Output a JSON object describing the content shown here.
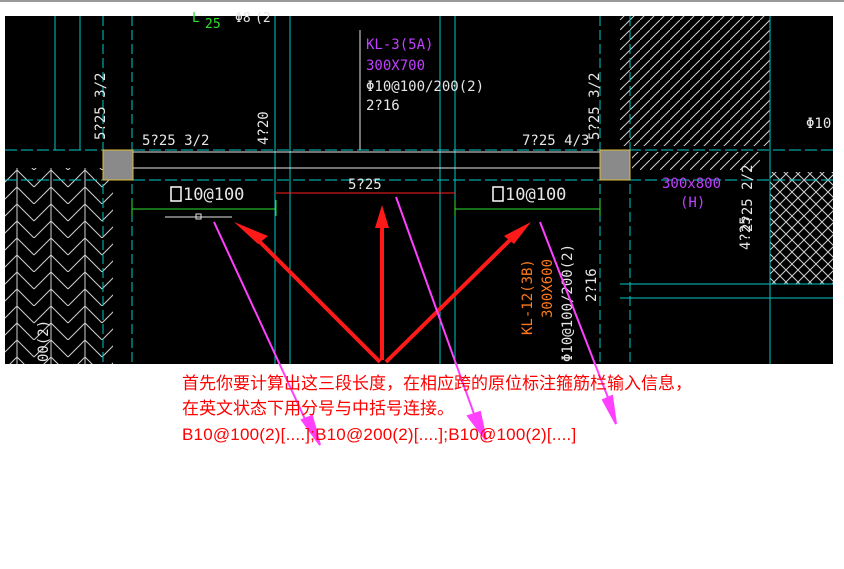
{
  "colors": {
    "background": "#000000",
    "axis_cyan": "#00c8c8",
    "beam_white": "#e6e6e6",
    "label_magenta": "#c040ff",
    "label_orange": "#ff7a1a",
    "arrow_red": "#ff1a1a",
    "arrow_magenta": "#ff40ff",
    "dim_green": "#30e030",
    "note_red": "#ff0000",
    "column_gray": "#8a8a8a"
  },
  "drawing": {
    "left_top_labels": [
      "L",
      "25",
      "Φ8",
      "(2"
    ],
    "beam_kl3": {
      "name": "KL-3(5A)",
      "size": "300X700",
      "stirrup": "Φ10@100/200(2)",
      "top_bars": "2?16"
    },
    "left_top_rebar": "5?25 3/2",
    "left_support_rebar": "5?25 3/2",
    "left_vertical_rebar": "4?20",
    "right_vertical_rebar": "5?25 3/2",
    "right_support_rebar": "7?25 4/3",
    "far_right_label": "Φ10",
    "mid_span_rebar": "5?25",
    "left_stirrup": "10@100",
    "right_stirrup": "10@100",
    "right_beam": {
      "size": "300x800",
      "suffix": "(H)"
    },
    "right_side_rebar_a": "2?25 2/2",
    "right_side_rebar_b": "4?25",
    "beam_kl12": {
      "name": "KL-12(3B)",
      "size": "300X600",
      "stirrup_partial": "Φ10@100/200(2)",
      "top_bars": "2?16"
    },
    "left_edge_label": "00(2)"
  },
  "note": {
    "line1": "首先你要计算出这三段长度，在相应跨的原位标注箍筋栏输入信息，",
    "line2": "在英文状态下用分号与中括号连接。",
    "line3": "B10@100(2)[....];B10@200(2)[....];B10@100(2)[....]"
  }
}
